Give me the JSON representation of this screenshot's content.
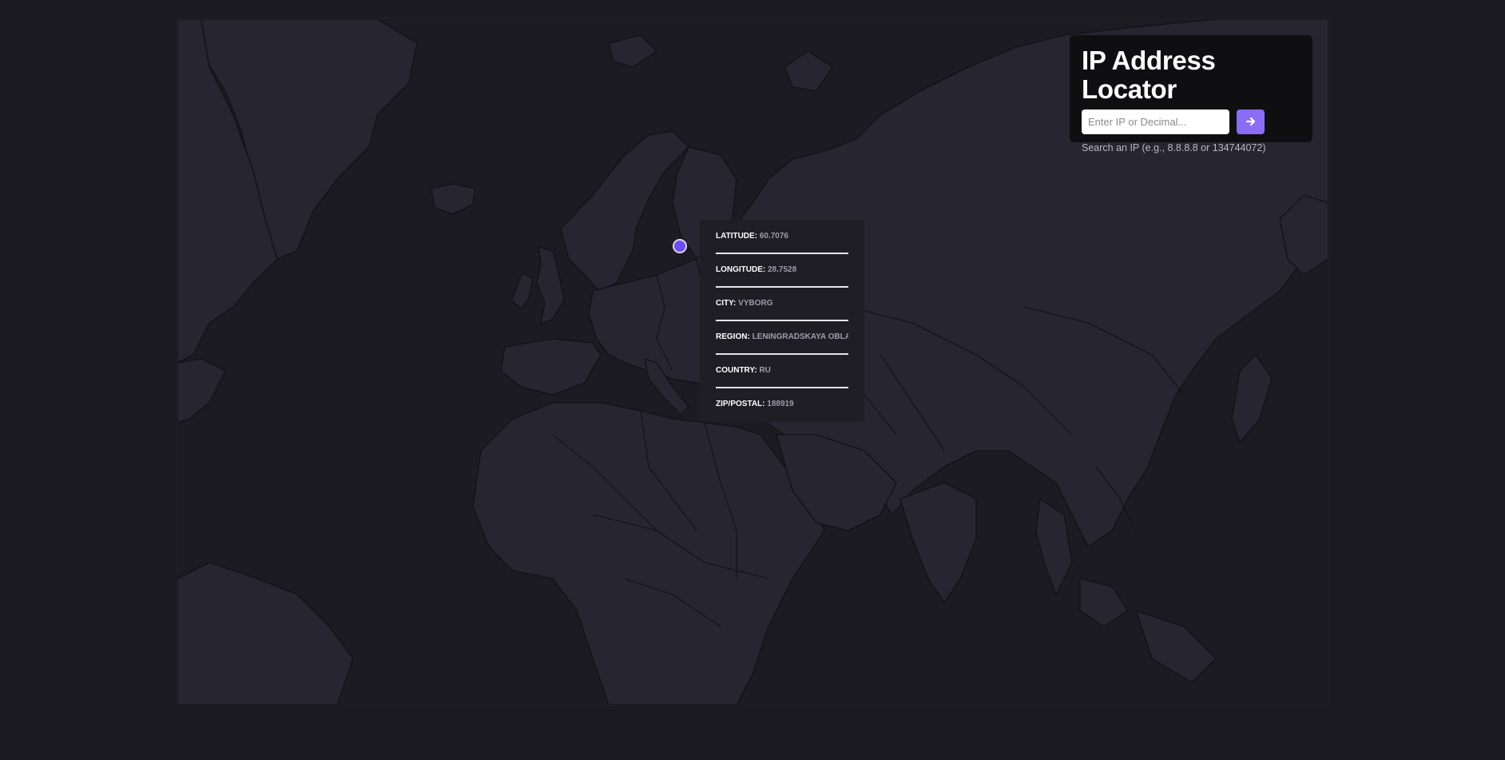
{
  "app": {
    "title": "IP Address Locator"
  },
  "search": {
    "placeholder": "Enter IP or Decimal...",
    "value": "",
    "button_icon": "arrow-right-icon",
    "hint": "Search an IP (e.g., 8.8.8.8 or 134744072)"
  },
  "result": {
    "rows": [
      {
        "label": "LATITUDE:",
        "value": "60.7076"
      },
      {
        "label": "LONGITUDE:",
        "value": "28.7528"
      },
      {
        "label": "CITY:",
        "value": "VYBORG"
      },
      {
        "label": "REGION:",
        "value": "LENINGRADSKAYA OBLAST'"
      },
      {
        "label": "COUNTRY:",
        "value": "RU"
      },
      {
        "label": "ZIP/POSTAL:",
        "value": "188919"
      }
    ]
  },
  "colors": {
    "background": "#1b1a21",
    "land": "#27252f",
    "ocean": "#1c1b22",
    "accent": "#8b6cf4",
    "marker": "#6c4df2"
  }
}
